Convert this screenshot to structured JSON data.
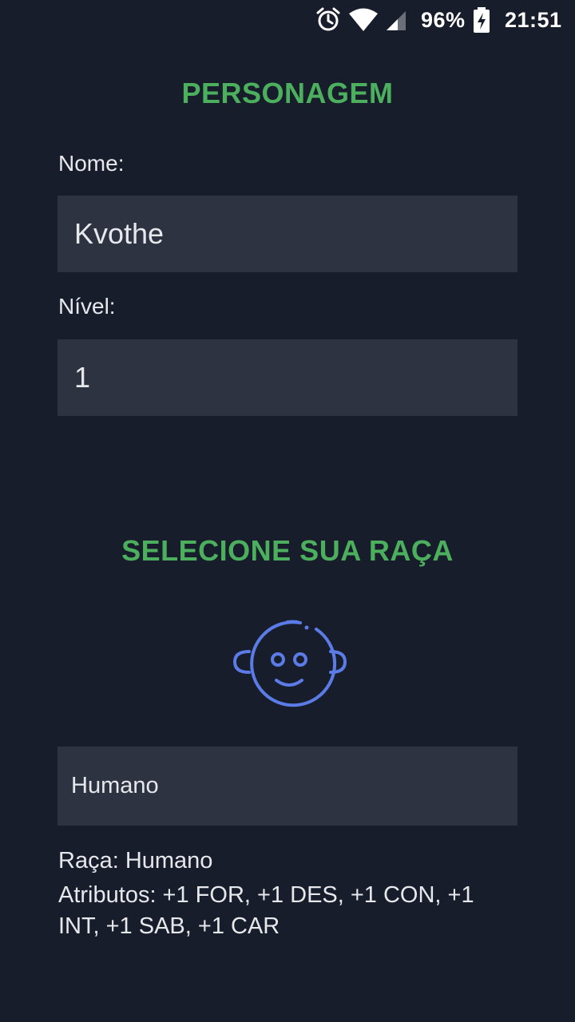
{
  "status_bar": {
    "alarm_icon": "alarm-clock-icon",
    "wifi_icon": "wifi-icon",
    "signal_icon": "cell-signal-icon",
    "battery_percent": "96%",
    "battery_icon": "battery-charging-icon",
    "time": "21:51"
  },
  "character": {
    "title": "PERSONAGEM",
    "name_label": "Nome:",
    "name_value": "Kvothe",
    "level_label": "Nível:",
    "level_value": "1"
  },
  "race": {
    "title": "SELECIONE SUA RAÇA",
    "icon": "baby-face-icon",
    "selected": "Humano",
    "race_line": "Raça: Humano",
    "attributes_line": "Atributos: +1 FOR, +1 DES, +1 CON, +1 INT, +1 SAB, +1 CAR"
  },
  "colors": {
    "background": "#181d2b",
    "field_background": "#2e3341",
    "accent_green": "#4caf5e",
    "icon_blue": "#5b7be6"
  }
}
